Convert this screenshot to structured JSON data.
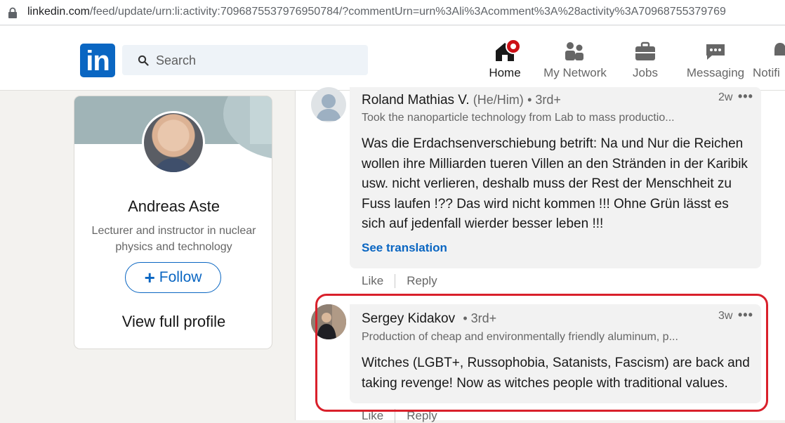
{
  "browser": {
    "url_host": "linkedin.com",
    "url_path": "/feed/update/urn:li:activity:7096875537976950784/?commentUrn=urn%3Ali%3Acomment%3A%28activity%3A70968755379769"
  },
  "nav": {
    "search_placeholder": "Search",
    "items": [
      {
        "label": "Home",
        "icon": "home-icon"
      },
      {
        "label": "My Network",
        "icon": "network-icon"
      },
      {
        "label": "Jobs",
        "icon": "briefcase-icon"
      },
      {
        "label": "Messaging",
        "icon": "messaging-icon"
      },
      {
        "label": "Notifi",
        "icon": "bell-icon"
      }
    ]
  },
  "profile_card": {
    "name": "Andreas Aste",
    "headline": "Lecturer and instructor in nuclear physics and technology",
    "follow_label": "Follow",
    "view_profile_label": "View full profile"
  },
  "comments": [
    {
      "name": "Roland Mathias V.",
      "pronouns": "(He/Him)",
      "degree": "• 3rd+",
      "headline": "Took the nanoparticle technology from Lab to mass productio...",
      "time": "2w",
      "text": "Was die Erdachsenverschiebung betrift: Na und Nur die Reichen wollen ihre Milliarden tueren Villen an den Stränden in der Karibik usw. nicht verlieren, deshalb muss der Rest der Menschheit zu Fuss laufen !?? Das wird nicht kommen !!! Ohne Grün lässt es sich auf jedenfall wierder besser leben !!!",
      "see_translation": "See translation",
      "like_label": "Like",
      "reply_label": "Reply"
    },
    {
      "name": "Sergey Kidakov",
      "degree": "• 3rd+",
      "headline": "Production of cheap and environmentally friendly aluminum, p...",
      "time": "3w",
      "text": "Witches (LGBT+, Russophobia, Satanists, Fascism) are back and taking revenge! Now as witches people with traditional values.",
      "like_label": "Like",
      "reply_label": "Reply"
    }
  ],
  "colors": {
    "brand": "#0a66c2",
    "highlight": "#d9202b",
    "badge": "#cc1016"
  }
}
